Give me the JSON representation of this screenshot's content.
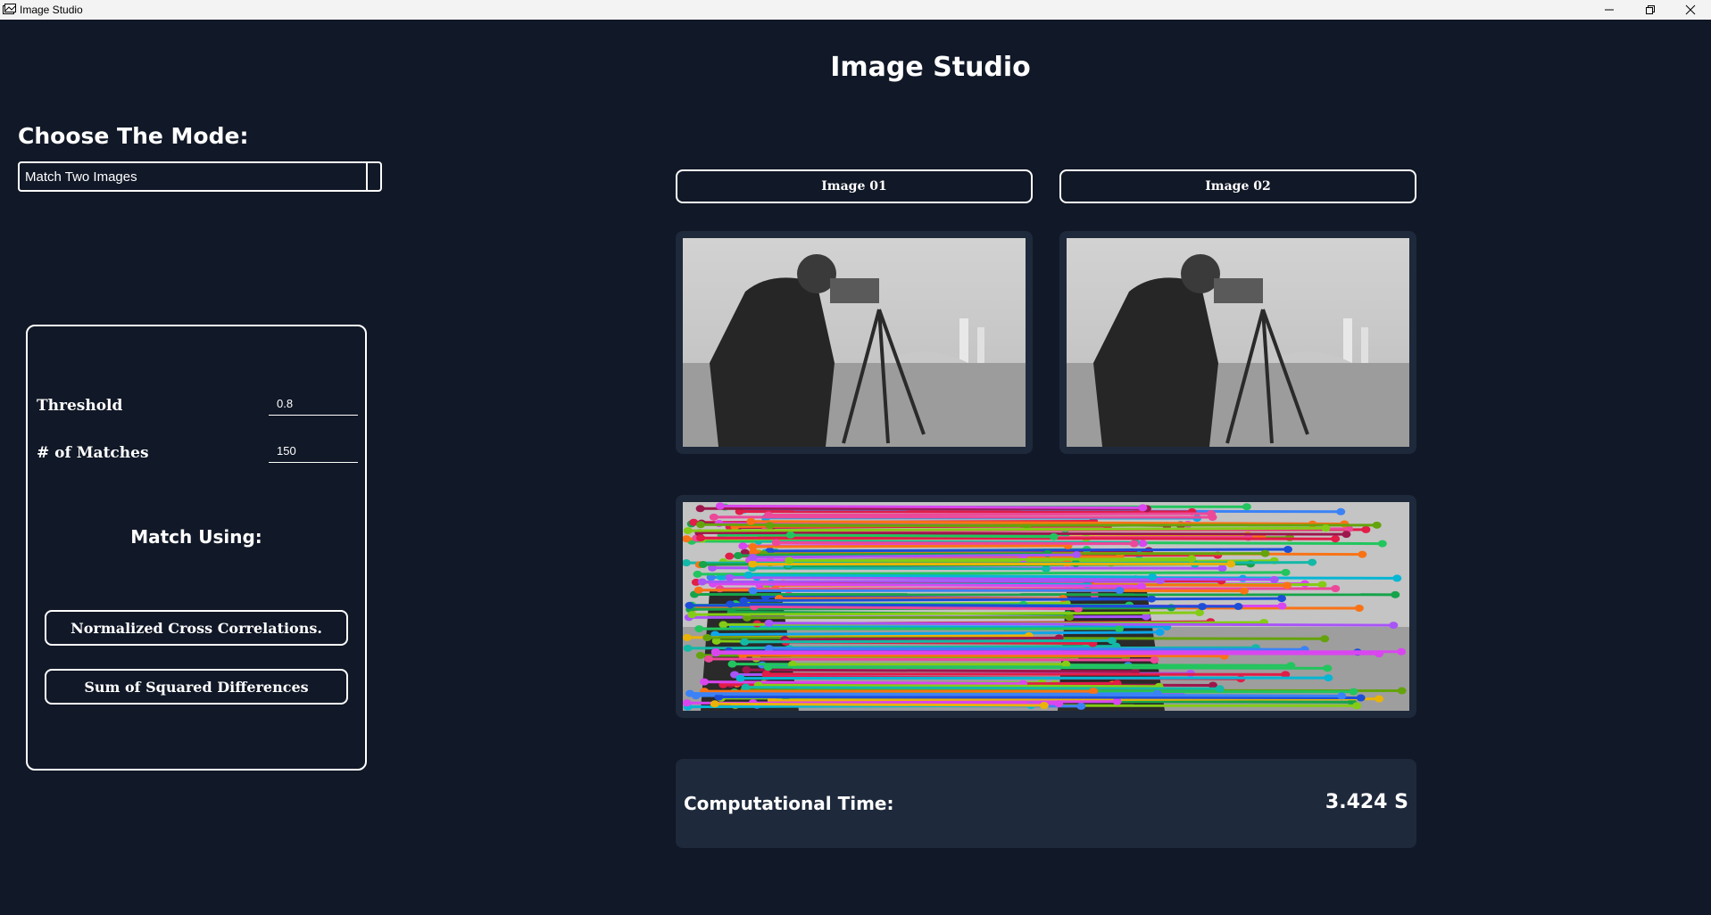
{
  "window": {
    "title": "Image Studio",
    "controls": [
      "minimize-icon",
      "restore-icon",
      "close-icon"
    ]
  },
  "app_title": "Image Studio",
  "mode": {
    "label": "Choose The Mode:",
    "selected": "Match Two Images"
  },
  "params": {
    "threshold_label": "Threshold",
    "threshold_value": "0.8",
    "matches_label": "# of Matches",
    "matches_value": "150",
    "match_using_label": "Match Using:",
    "methods": [
      "Normalized Cross Correlations.",
      "Sum of Squared Differences"
    ]
  },
  "images": {
    "image1_button": "Image 01",
    "image2_button": "Image 02"
  },
  "result": {
    "time_label": "Computational Time:",
    "time_value": "3.424 S"
  },
  "colors": {
    "background": "#111827",
    "panel": "#1e293b",
    "border": "#ffffff",
    "text": "#ffffff"
  }
}
